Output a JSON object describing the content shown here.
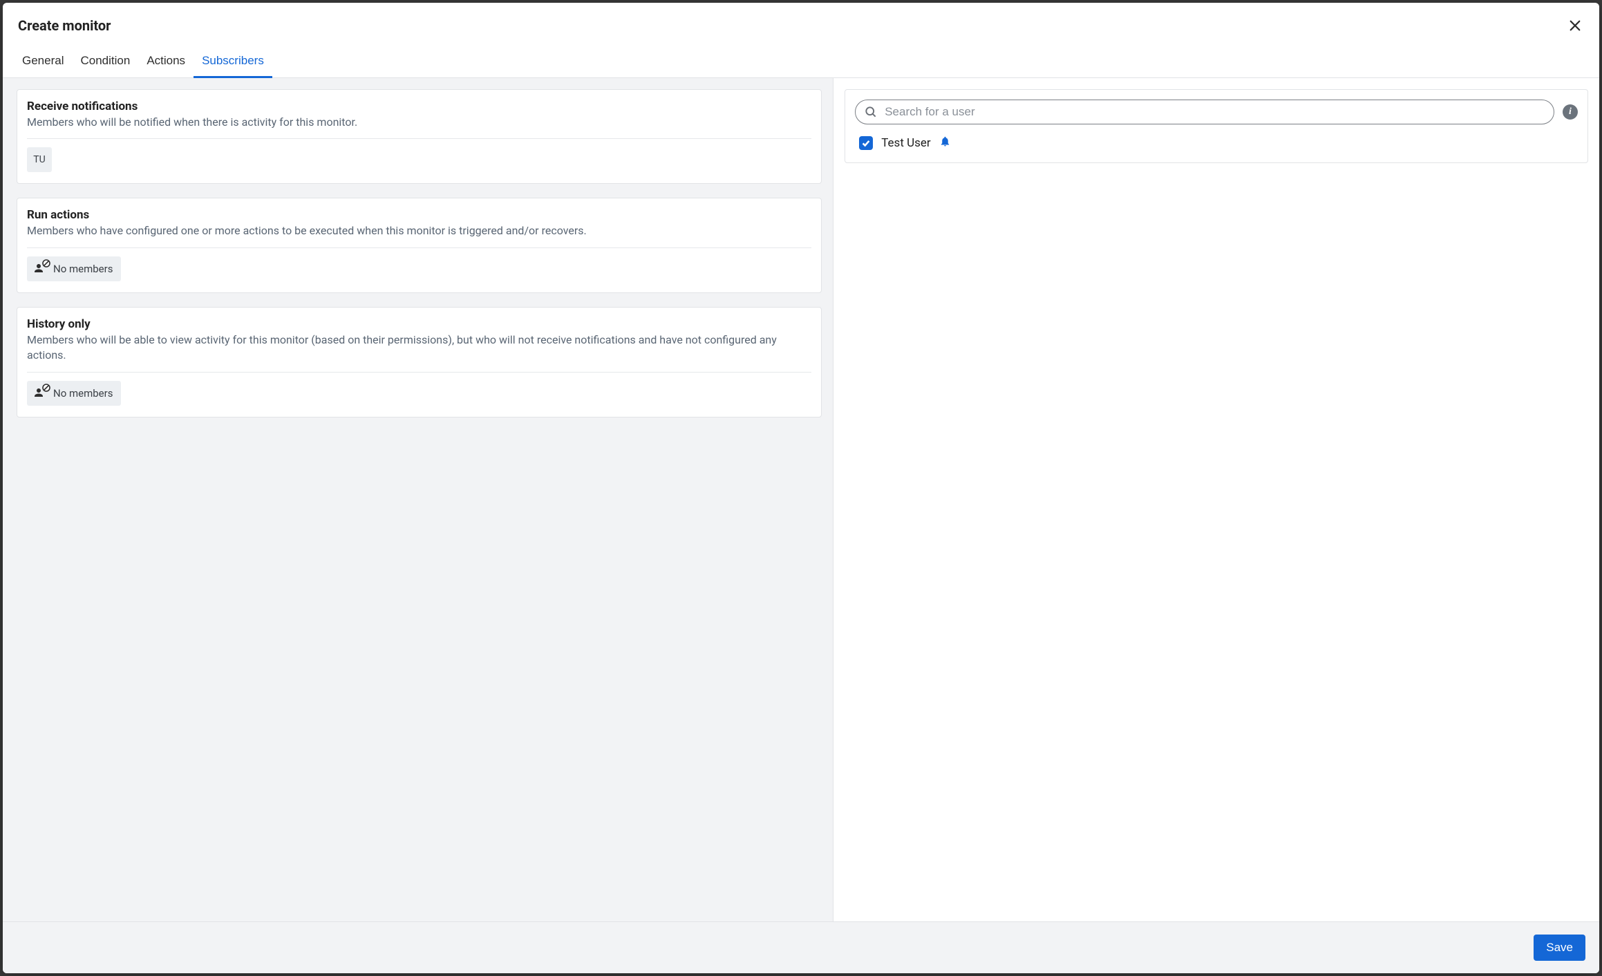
{
  "modal": {
    "title": "Create monitor"
  },
  "tabs": {
    "general": "General",
    "condition": "Condition",
    "actions": "Actions",
    "subscribers": "Subscribers",
    "active": "subscribers"
  },
  "sections": {
    "receive": {
      "title": "Receive notifications",
      "desc": "Members who will be notified when there is activity for this monitor.",
      "member_initials": "TU"
    },
    "run": {
      "title": "Run actions",
      "desc": "Members who have configured one or more actions to be executed when this monitor is triggered and/or recovers.",
      "empty_label": "No members"
    },
    "history": {
      "title": "History only",
      "desc": "Members who will be able to view activity for this monitor (based on their permissions), but who will not receive notifications and have not configured any actions.",
      "empty_label": "No members"
    }
  },
  "search": {
    "placeholder": "Search for a user",
    "value": ""
  },
  "users": [
    {
      "name": "Test User",
      "checked": true,
      "notifies": true
    }
  ],
  "footer": {
    "save_label": "Save"
  }
}
